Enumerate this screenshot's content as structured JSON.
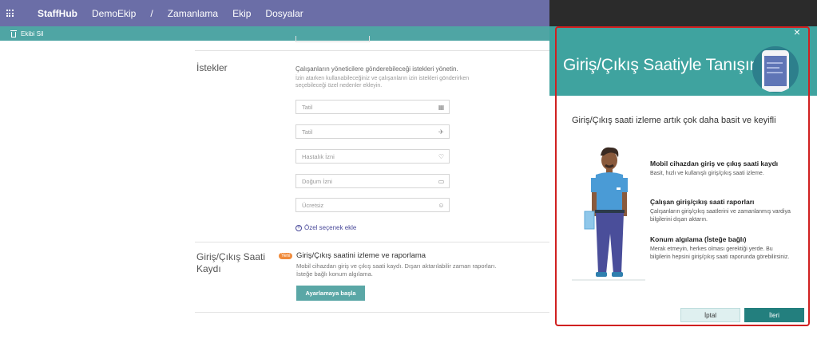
{
  "topbar": {
    "app_name": "StaffHub",
    "team": "DemoEkip",
    "separator": "/",
    "nav": [
      "Zamanlama",
      "Ekip",
      "Dosyalar"
    ],
    "icon": "waffle-icon"
  },
  "subbar": {
    "delete_team_label": "Ekibi Sil",
    "icon": "trash-icon"
  },
  "requests": {
    "title": "İstekler",
    "description": "Çalışanların yöneticilere gönderebileceği istekleri yönetin.",
    "hint": "İzin atarken kullanabileceğiniz ve çalışanların izin istekleri gönderirken seçebileceği özel nedenler ekleyin.",
    "fields": [
      {
        "value": "Tatil",
        "icon": "briefcase-icon"
      },
      {
        "value": "Tatil",
        "icon": "airplane-icon"
      },
      {
        "value": "Hastalık İzni",
        "icon": "heart-icon"
      },
      {
        "value": "Doğum İzni",
        "icon": "baby-icon"
      },
      {
        "value": "Ücretsiz",
        "icon": "smiley-icon"
      }
    ],
    "add_custom_label": "Özel seçenek ekle"
  },
  "timeclock": {
    "title": "Giriş/Çıkış Saati Kaydı",
    "badge": "Yeni",
    "feature_title": "Giriş/Çıkış saatini izleme ve raporlama",
    "feature_desc": "Mobil cihazdan giriş ve çıkış saati kaydı. Dışarı aktarılabilir zaman raporları. İsteğe bağlı konum algılama.",
    "setup_button": "Ayarlamaya başla"
  },
  "panel": {
    "title": "Giriş/Çıkış Saatiyle Tanışın",
    "close": "×",
    "subtitle": "Giriş/Çıkış saati izleme artık çok daha basit ve keyifli",
    "features": [
      {
        "title": "Mobil cihazdan giriş ve çıkış saati kaydı",
        "body": "Basit, hızlı ve kullanışlı giriş/çıkış saati izleme."
      },
      {
        "title": "Çalışan giriş/çıkış saati raporları",
        "body": "Çalışanların giriş/çıkış saatlerini ve zamanlanmış vardiya bilgilerini dışarı aktarın."
      },
      {
        "title": "Konum algılama (İsteğe bağlı)",
        "body": "Merak etmeyin, herkes olması gerektiği yerde. Bu bilgilerin hepsini giriş/çıkış saati raporunda görebilirsiniz."
      }
    ],
    "cancel_button": "İptal",
    "next_button": "İleri"
  },
  "colors": {
    "topbar": "#6b6ea7",
    "subbar": "#4fa5a4",
    "panel_header": "#3fa39f",
    "next_button": "#237f7e",
    "highlight": "#d02020"
  }
}
